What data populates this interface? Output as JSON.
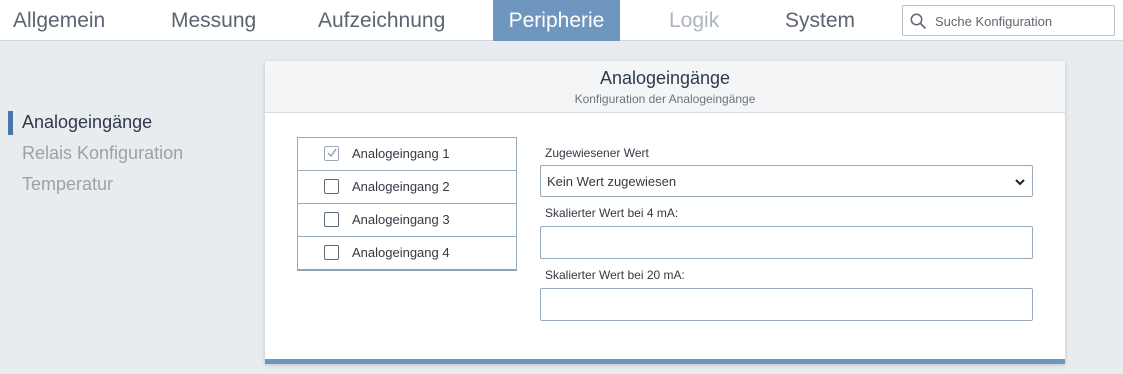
{
  "nav": {
    "tabs": [
      {
        "label": "Allgemein"
      },
      {
        "label": "Messung"
      },
      {
        "label": "Aufzeichnung"
      },
      {
        "label": "Peripherie"
      },
      {
        "label": "Logik"
      },
      {
        "label": "System"
      }
    ],
    "active_tab": "Peripherie",
    "disabled_tab": "Logik",
    "search": {
      "placeholder": "Suche Konfiguration",
      "value": ""
    }
  },
  "sidebar": {
    "items": [
      {
        "label": "Analogeingänge"
      },
      {
        "label": "Relais Konfiguration"
      },
      {
        "label": "Temperatur"
      }
    ],
    "active_item": "Analogeingänge"
  },
  "panel": {
    "title": "Analogeingänge",
    "subtitle": "Konfiguration der Analogeingänge",
    "inputs": [
      {
        "label": "Analogeingang 1",
        "checked": true
      },
      {
        "label": "Analogeingang 2",
        "checked": false
      },
      {
        "label": "Analogeingang 3",
        "checked": false
      },
      {
        "label": "Analogeingang 4",
        "checked": false
      }
    ],
    "assigned_value": {
      "label": "Zugewiesener Wert",
      "selected": "Kein Wert zugewiesen"
    },
    "scaled_4ma": {
      "label": "Skalierter Wert bei 4 mA:",
      "value": ""
    },
    "scaled_20ma": {
      "label": "Skalierter Wert bei 20 mA:",
      "value": ""
    }
  },
  "colors": {
    "accent": "#6e96bf",
    "sidebar_indicator": "#4a75a8",
    "background": "#e9ecef"
  }
}
